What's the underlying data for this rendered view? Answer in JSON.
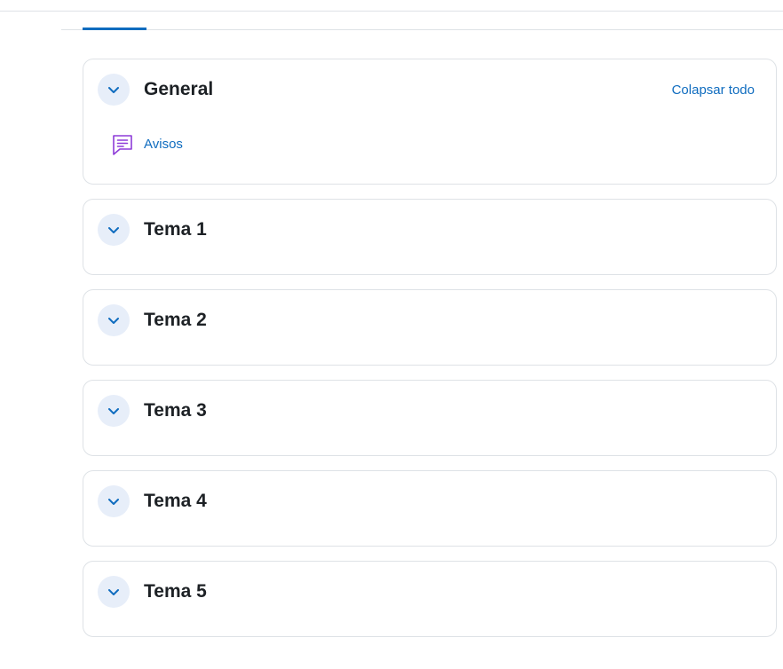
{
  "colors": {
    "accent": "#0f6cbf",
    "toggle_bg": "#e7eef9",
    "forum_icon": "#8e3bd8",
    "border": "#dee2e6",
    "title_text": "#1d2125"
  },
  "course_index": {
    "collapse_all_label": "Colapsar todo",
    "sections": [
      {
        "title": "General",
        "toggle_icon": "chevron-down-icon",
        "activities": [
          {
            "label": "Avisos",
            "icon": "forum-icon"
          }
        ]
      },
      {
        "title": "Tema 1",
        "toggle_icon": "chevron-down-icon",
        "activities": []
      },
      {
        "title": "Tema 2",
        "toggle_icon": "chevron-down-icon",
        "activities": []
      },
      {
        "title": "Tema 3",
        "toggle_icon": "chevron-down-icon",
        "activities": []
      },
      {
        "title": "Tema 4",
        "toggle_icon": "chevron-down-icon",
        "activities": []
      },
      {
        "title": "Tema 5",
        "toggle_icon": "chevron-down-icon",
        "activities": []
      }
    ]
  }
}
